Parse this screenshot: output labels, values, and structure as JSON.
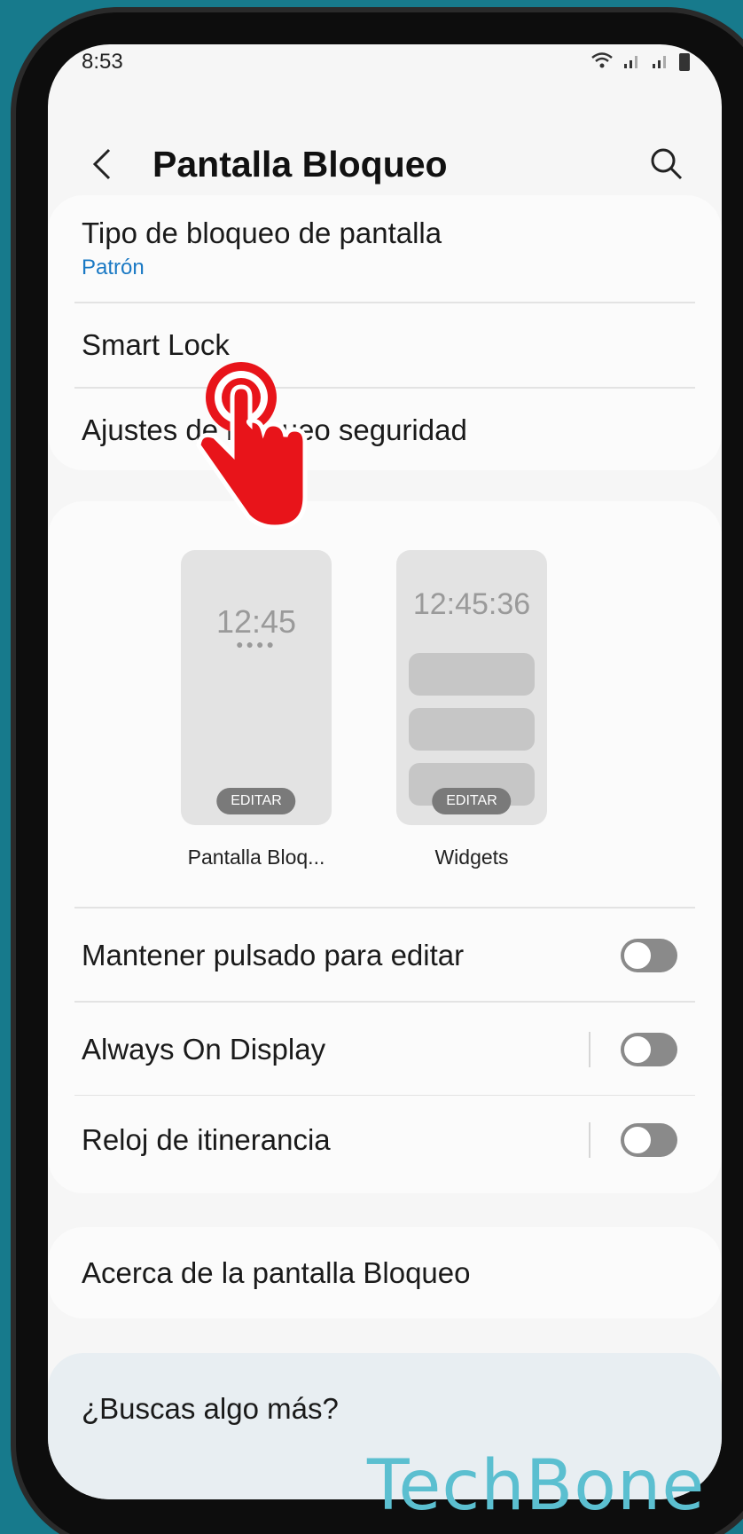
{
  "status_bar": {
    "time": "8:53"
  },
  "header": {
    "title": "Pantalla Bloqueo"
  },
  "security": {
    "lock_type_label": "Tipo de bloqueo de pantalla",
    "lock_type_value": "Patrón",
    "smart_lock": "Smart Lock",
    "security_settings": "Ajustes de bloqueo seguridad"
  },
  "previews": [
    {
      "time": "12:45",
      "edit": "EDITAR",
      "label": "Pantalla Bloq..."
    },
    {
      "time": "12:45:36",
      "edit": "EDITAR",
      "label": "Widgets"
    }
  ],
  "toggles": [
    {
      "label": "Mantener pulsado para editar",
      "on": false
    },
    {
      "label": "Always On Display",
      "on": false
    },
    {
      "label": "Reloj de itinerancia",
      "on": false
    }
  ],
  "about": {
    "label": "Acerca de la pantalla Bloqueo"
  },
  "footer": {
    "label": "¿Buscas algo más?"
  },
  "watermark": "TechBone",
  "colors": {
    "accent": "#1a79c4",
    "background": "#177a8c",
    "hand": "#e8141a"
  },
  "icons": [
    "back-icon",
    "search-icon",
    "wifi-icon",
    "signal-icon",
    "battery-icon",
    "tap-hand-icon"
  ]
}
